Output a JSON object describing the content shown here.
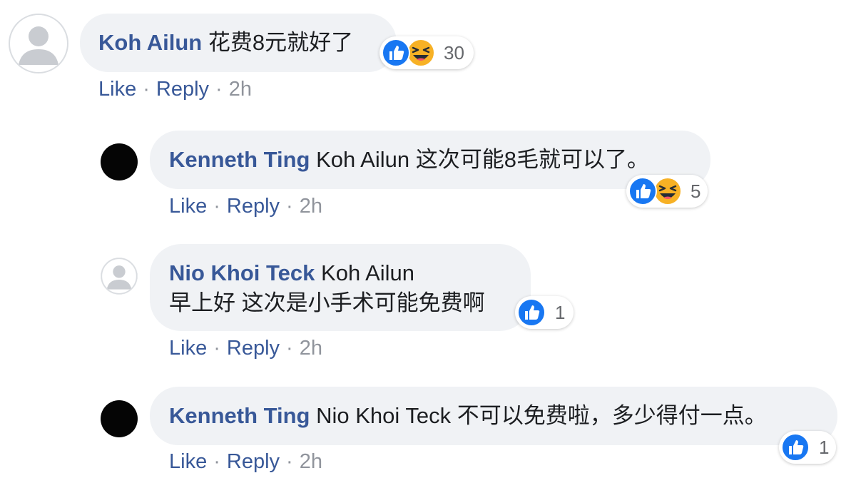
{
  "comments": [
    {
      "author": "Koh Ailun",
      "mention": "",
      "text": "花费8元就好了",
      "text_line2": "",
      "avatar": "default-avatar",
      "reactions": [
        "like-icon",
        "haha-icon"
      ],
      "reaction_count": "30",
      "actions": {
        "like": "Like",
        "reply": "Reply",
        "separator": "·",
        "time": "2h"
      }
    },
    {
      "author": "Kenneth Ting",
      "mention": "Koh Ailun",
      "text": "这次可能8毛就可以了。",
      "text_line2": "",
      "avatar": "black-avatar",
      "reactions": [
        "like-icon",
        "haha-icon"
      ],
      "reaction_count": "5",
      "actions": {
        "like": "Like",
        "reply": "Reply",
        "separator": "·",
        "time": "2h"
      }
    },
    {
      "author": "Nio Khoi Teck",
      "mention": "Koh Ailun",
      "text": "",
      "text_line2": "早上好 这次是小手术可能免费啊",
      "avatar": "default-avatar",
      "reactions": [
        "like-icon"
      ],
      "reaction_count": "1",
      "actions": {
        "like": "Like",
        "reply": "Reply",
        "separator": "·",
        "time": "2h"
      }
    },
    {
      "author": "Kenneth Ting",
      "mention": "Nio Khoi Teck",
      "text": "不可以免费啦，多少得付一点。",
      "text_line2": "",
      "avatar": "black-avatar",
      "reactions": [
        "like-icon"
      ],
      "reaction_count": "1",
      "actions": {
        "like": "Like",
        "reply": "Reply",
        "separator": "·",
        "time": "2h"
      }
    }
  ],
  "colors": {
    "author": "#385898",
    "bubble": "#f0f2f5",
    "like_blue": "#1877f2",
    "haha_yellow": "#f7b125",
    "meta_gray": "#90949c"
  }
}
